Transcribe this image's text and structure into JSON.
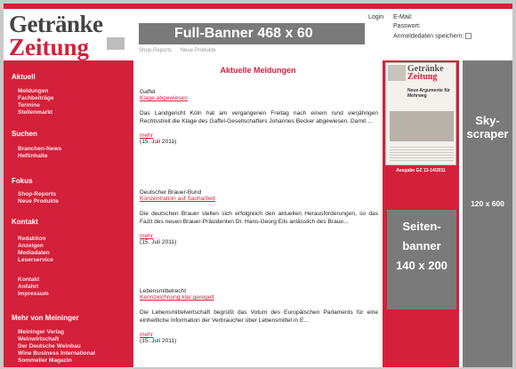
{
  "logo": {
    "line1": "Getränke",
    "line2": "Zeitung"
  },
  "header": {
    "banner": "Full-Banner 468 x 60",
    "subnav": [
      "Shop-Reports",
      "Neue Produkte"
    ]
  },
  "login": {
    "label": "Login",
    "email_label": "E-Mail:",
    "password_label": "Passwort:",
    "remember_label": "Anmeldedaten speichern:"
  },
  "sidebar": {
    "sections": [
      {
        "title": "Aktuell",
        "items": [
          "Meldungen",
          "Fachbeiträge",
          "Termine",
          "Stellenmarkt"
        ]
      },
      {
        "title": "Suchen",
        "items": [
          "Branchen-News",
          "Heftinhalte"
        ]
      },
      {
        "title": "Fokus",
        "items": [
          "Shop-Reports",
          "Neue Produkte"
        ]
      },
      {
        "title": "Kontakt",
        "items": [
          "Redaktion",
          "Anzeigen",
          "Mediadaten",
          "Leserservice"
        ]
      },
      {
        "title": "",
        "items": [
          "Kontakt",
          "Anfahrt",
          "Impressum"
        ]
      },
      {
        "title": "Mehr von Meininger",
        "items": [
          "Meininger Verlag",
          "Weinwirtschaft",
          "Der Deutsche Weinbau",
          "Wine Business International",
          "Sommelier Magazin"
        ]
      }
    ]
  },
  "content": {
    "heading": "Aktuelle Meldungen",
    "articles": [
      {
        "category": "Gaffel",
        "link": "Klage abgewiesen",
        "body": "Das Landgericht Köln hat am vergangenen Freitag nach einem rund vierjährigen Rechtsstreit die Klage des Gaffel-Gesellschafters Johannes Becker abgewiesen. Damit ...",
        "more": "mehr",
        "date": "(15. Juli 2011)"
      },
      {
        "category": "Deutscher Brauer-Bund",
        "link": "Konzentration auf Sacharbeit",
        "body": "Die deutschen Brauer stellen sich erfolgreich den aktuellen Herausforderungen, so das Fazit des neuen Brauer-Präsidenten Dr. Hans-Georg Eils anlässlich des Braue...",
        "more": "mehr",
        "date": "(15. Juli 2011)"
      },
      {
        "category": "Lebensmittelrecht",
        "link": "Kennzeichnung klar geregelt",
        "body": "Die Lebensmittelwirtschaft begrüßt das Votum des Europäischen Parlaments für eine einheitliche Information der Verbraucher über Lebensmittel in E...",
        "more": "mehr",
        "date": "(15. Juli 2011)"
      }
    ]
  },
  "magazine": {
    "title1": "Getränke",
    "title2": "Zeitung",
    "headline": "Neue Argumente für Mehrweg",
    "caption": "Ausgabe GZ 13-14/2011"
  },
  "ads": {
    "seiten": [
      "Seiten-",
      "banner",
      "140 x 200"
    ],
    "sky_title": [
      "Sky-",
      "scraper"
    ],
    "sky_size": "120 x 600"
  },
  "colors": {
    "brand_red": "#d4203a",
    "ad_gray": "#7a7a7a"
  }
}
